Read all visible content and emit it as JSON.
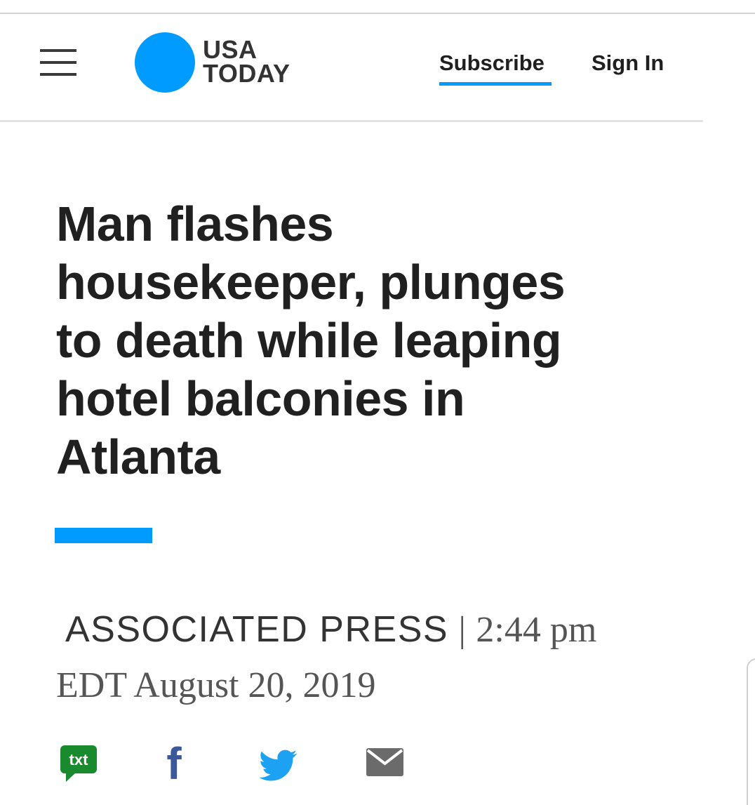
{
  "header": {
    "logo": {
      "line1": "USA",
      "line2": "TODAY",
      "dot_color": "#009bff"
    },
    "subscribe_label": "Subscribe",
    "signin_label": "Sign In",
    "menu_icon": "hamburger-menu-icon"
  },
  "article": {
    "headline": "Man flashes housekeeper, plunges to death while leaping hotel balconies in Atlanta",
    "byline": {
      "source": "ASSOCIATED PRESS",
      "separator": "|",
      "timestamp": "2:44 pm EDT August 20, 2019"
    }
  },
  "share": {
    "icons": [
      "txt-message-icon",
      "facebook-icon",
      "twitter-icon",
      "email-icon"
    ],
    "txt_label": "txt",
    "fb_label": "f"
  },
  "colors": {
    "accent": "#009bff",
    "text": "#202020",
    "txt_green": "#1a8a2e",
    "facebook_blue": "#3b5998",
    "twitter_blue": "#1da1f2",
    "email_gray": "#6b6b6b"
  }
}
